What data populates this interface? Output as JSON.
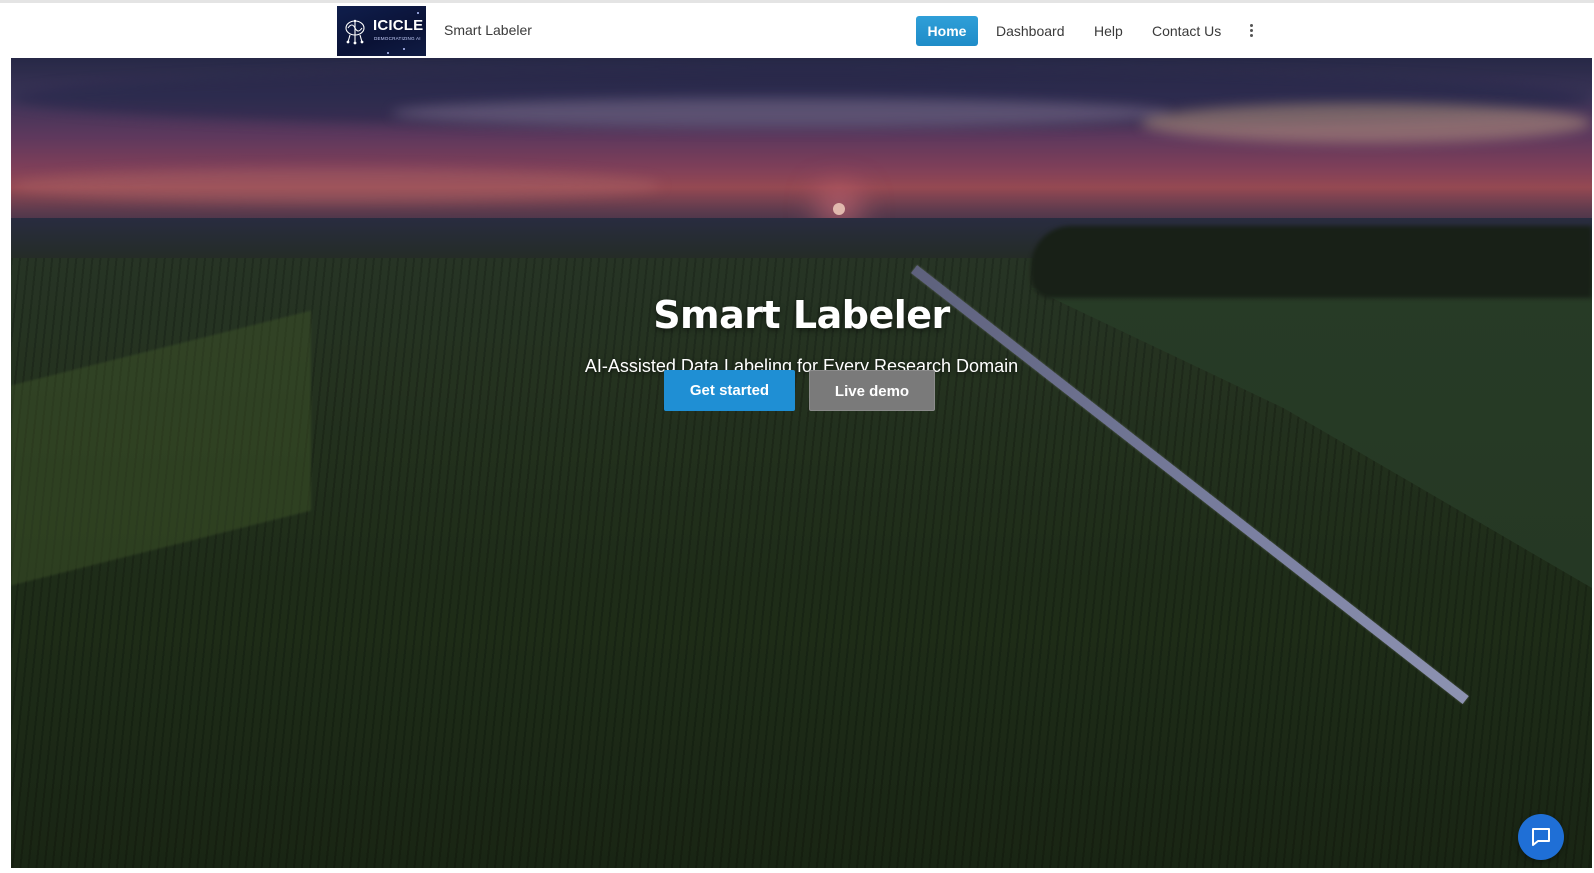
{
  "header": {
    "logo": {
      "title": "ICICLE",
      "tagline": "DEMOCRATIZING AI"
    },
    "brand_name": "Smart Labeler",
    "nav": {
      "items": [
        {
          "label": "Home",
          "active": true
        },
        {
          "label": "Dashboard",
          "active": false
        },
        {
          "label": "Help",
          "active": false
        },
        {
          "label": "Contact Us",
          "active": false
        }
      ],
      "more_icon": "vertical-ellipsis-icon"
    },
    "colors": {
      "active_nav": "#2196d3"
    }
  },
  "hero": {
    "title": "Smart Labeler",
    "subtitle": "AI-Assisted Data Labeling for Every Research Domain",
    "primary_button": "Get started",
    "secondary_button": "Live demo",
    "background": "aerial sunset over cornfields with road",
    "colors": {
      "primary_button": "#1f8fd4",
      "secondary_button": "#7a7a7a"
    }
  },
  "chat_widget": {
    "icon": "chat-bubble-icon",
    "color": "#1f6fd6"
  }
}
